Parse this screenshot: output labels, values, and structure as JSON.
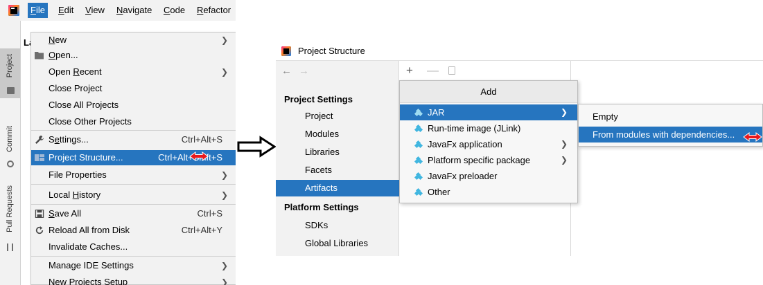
{
  "menubar": {
    "items": [
      {
        "label": "File",
        "mnemonic": "F",
        "rest": "ile",
        "active": true
      },
      {
        "label": "Edit",
        "mnemonic": "E",
        "rest": "dit"
      },
      {
        "label": "View",
        "mnemonic": "V",
        "rest": "iew"
      },
      {
        "label": "Navigate",
        "mnemonic": "N",
        "rest": "avigate"
      },
      {
        "label": "Code",
        "mnemonic": "C",
        "rest": "ode"
      },
      {
        "label": "Refactor",
        "mnemonic": "R",
        "rest": "efactor"
      }
    ]
  },
  "toolwindow_strip": {
    "tabs": [
      "Project",
      "Commit",
      "Pull Requests"
    ]
  },
  "project_panel": {
    "title": "Lab"
  },
  "file_menu": {
    "items": [
      {
        "label": "New",
        "mnemonic": "N",
        "rest": "ew",
        "submenu": true
      },
      {
        "label": "Open...",
        "mnemonic": "O",
        "rest": "pen...",
        "icon": "folder-open-icon"
      },
      {
        "label": "Open Recent",
        "pre": "Open ",
        "mnemonic": "R",
        "rest": "ecent",
        "submenu": true
      },
      {
        "label": "Close Project"
      },
      {
        "label": "Close All Projects"
      },
      {
        "label": "Close Other Projects"
      },
      {
        "label": "Settings...",
        "pre": "S",
        "mnemonic": "e",
        "rest": "ttings...",
        "shortcut": "Ctrl+Alt+S",
        "icon": "wrench-icon"
      },
      {
        "label": "Project Structure...",
        "shortcut": "Ctrl+Alt+Shift+S",
        "icon": "project-structure-icon",
        "highlighted": true
      },
      {
        "label": "File Properties",
        "submenu": true
      },
      {
        "label": "Local History",
        "pre": "Local ",
        "mnemonic": "H",
        "rest": "istory",
        "submenu": true
      },
      {
        "label": "Save All",
        "mnemonic": "S",
        "rest": "ave All",
        "shortcut": "Ctrl+S",
        "icon": "save-icon"
      },
      {
        "label": "Reload All from Disk",
        "shortcut": "Ctrl+Alt+Y",
        "icon": "reload-icon"
      },
      {
        "label": "Invalidate Caches..."
      },
      {
        "label": "Manage IDE Settings",
        "submenu": true
      },
      {
        "label": "New Projects Setup",
        "submenu": true
      }
    ]
  },
  "project_structure": {
    "title": "Project Structure",
    "sidebar": {
      "project_settings_header": "Project Settings",
      "project_settings_items": [
        "Project",
        "Modules",
        "Libraries",
        "Facets",
        "Artifacts"
      ],
      "selected": "Artifacts",
      "platform_settings_header": "Platform Settings",
      "platform_settings_items": [
        "SDKs",
        "Global Libraries"
      ]
    },
    "add_popup": {
      "header": "Add",
      "items": [
        {
          "label": "JAR",
          "submenu": true,
          "highlighted": true
        },
        {
          "label": "Run-time image (JLink)"
        },
        {
          "label": "JavaFx application",
          "submenu": true
        },
        {
          "label": "Platform specific package",
          "submenu": true
        },
        {
          "label": "JavaFx preloader"
        },
        {
          "label": "Other"
        }
      ]
    },
    "jar_submenu": {
      "items": [
        {
          "label": "Empty"
        },
        {
          "label": "From modules with dependencies...",
          "highlighted": true
        }
      ]
    }
  },
  "colors": {
    "selection": "#2675bf",
    "menu_bg": "#f2f2f2",
    "artifact_icon": "#40b6e0",
    "annotation_cursor": "#e8191c"
  }
}
